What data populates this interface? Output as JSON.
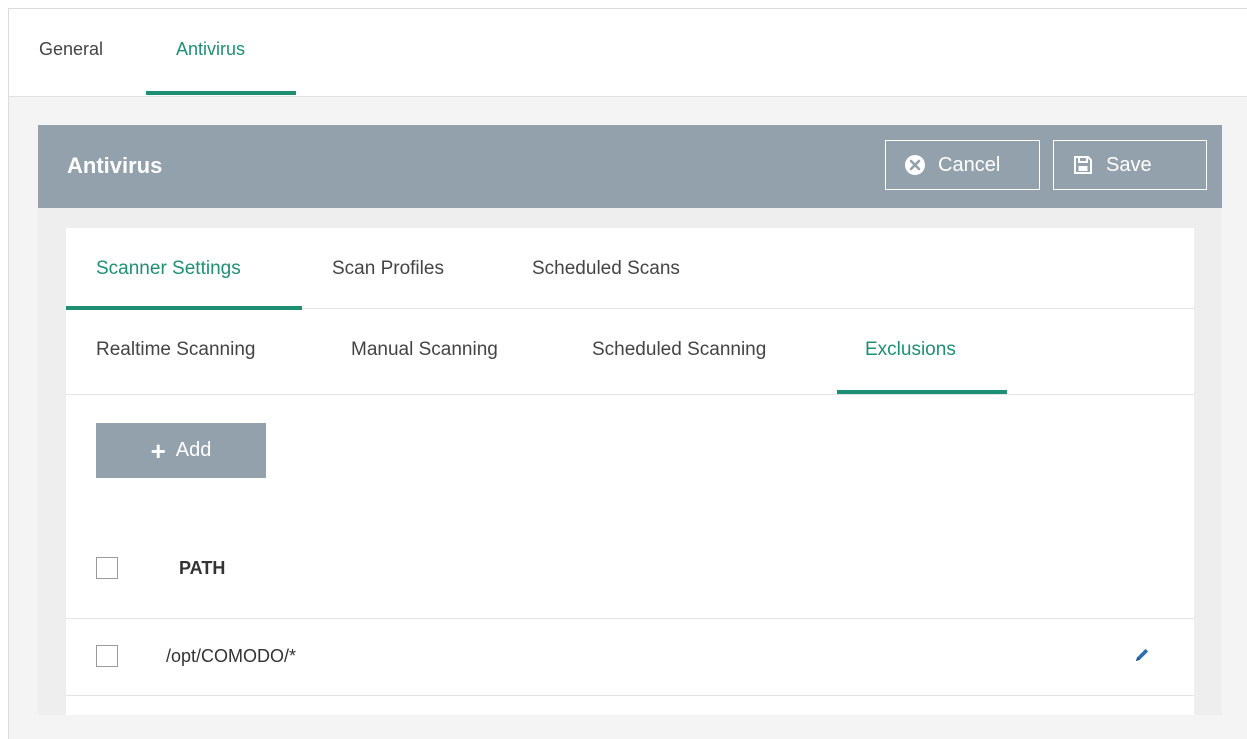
{
  "top_tabs": [
    {
      "label": "General",
      "active": false
    },
    {
      "label": "Antivirus",
      "active": true
    }
  ],
  "panel": {
    "title": "Antivirus",
    "cancel_label": "Cancel",
    "save_label": "Save"
  },
  "section_tabs": [
    {
      "label": "Scanner Settings",
      "active": true
    },
    {
      "label": "Scan Profiles",
      "active": false
    },
    {
      "label": "Scheduled Scans",
      "active": false
    }
  ],
  "sub_tabs": [
    {
      "label": "Realtime Scanning",
      "active": false
    },
    {
      "label": "Manual Scanning",
      "active": false
    },
    {
      "label": "Scheduled Scanning",
      "active": false
    },
    {
      "label": "Exclusions",
      "active": true
    }
  ],
  "add_button": {
    "label": "Add"
  },
  "table": {
    "header": "PATH",
    "rows": [
      {
        "path": "/opt/COMODO/*"
      }
    ]
  },
  "colors": {
    "accent": "#1f8f74",
    "header_bg": "#93a1ad",
    "edit_icon": "#2a6fb0"
  },
  "icons": {
    "cancel": "close-circle-icon",
    "save": "floppy-disk-icon",
    "add": "plus-icon",
    "edit": "pencil-icon"
  }
}
